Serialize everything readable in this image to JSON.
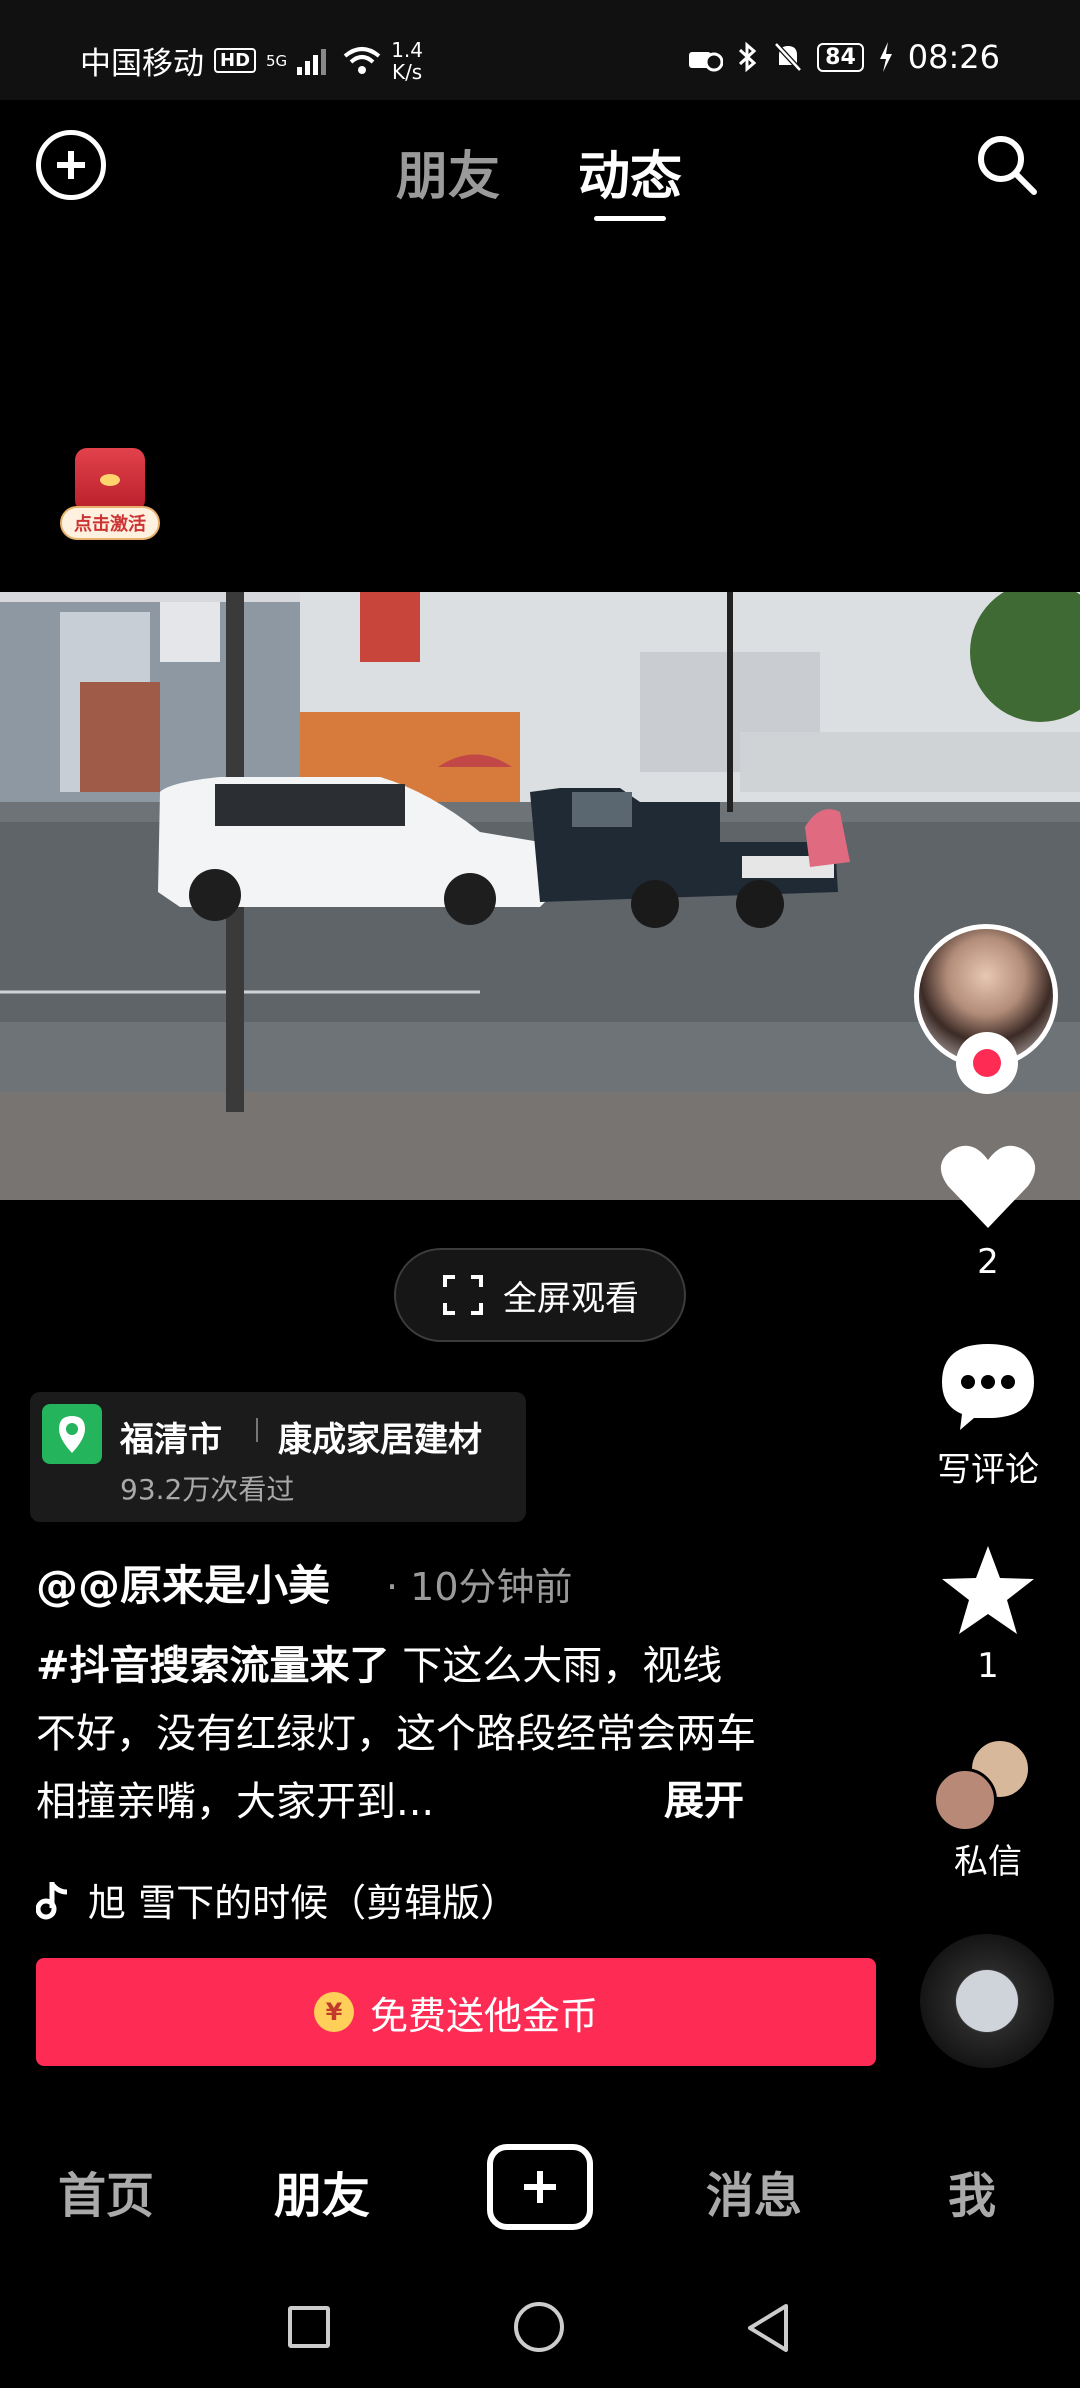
{
  "status_bar": {
    "carrier": "中国移动",
    "hd": "HD",
    "network": "5G",
    "speed_value": "1.4",
    "speed_unit": "K/s",
    "battery": "84",
    "time": "08:26"
  },
  "top_nav": {
    "tabs": [
      "朋友",
      "动态"
    ],
    "active_tab": "动态"
  },
  "red_packet": {
    "label": "点击激活"
  },
  "video": {
    "fullscreen_label": "全屏观看"
  },
  "location": {
    "city": "福清市",
    "place": "康成家居建材",
    "views": "93.2万次看过"
  },
  "post": {
    "author": "@@原来是小美",
    "time": "· 10分钟前",
    "hashtag": "#抖音搜索流量来了",
    "text": " 下这么大雨，视线不好，没有红绿灯，这个路段经常会两车相撞亲嘴，大家开到...",
    "expand": "展开",
    "music": "旭   雪下的时候（剪辑版）"
  },
  "coin_button": {
    "label": "免费送他金币",
    "icon": "¥"
  },
  "actions": {
    "like_count": "2",
    "comment_label": "写评论",
    "fav_count": "1",
    "dm_label": "私信"
  },
  "bottom_nav": {
    "home": "首页",
    "friends": "朋友",
    "messages": "消息",
    "me": "我"
  },
  "colors": {
    "accent": "#fe2c55",
    "location_green": "#24b45c",
    "background": "#000000"
  }
}
